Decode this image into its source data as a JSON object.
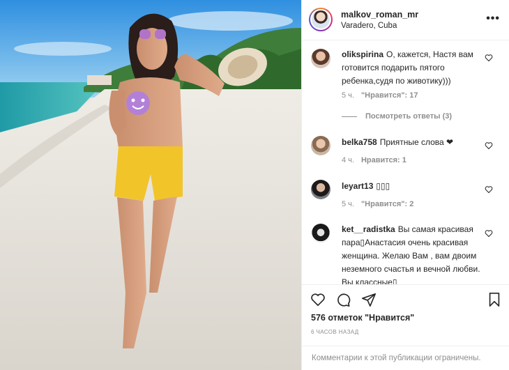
{
  "post": {
    "username": "malkov_roman_mr",
    "location": "Varadero, Cuba",
    "more_icon": "more-options-icon"
  },
  "comments": [
    {
      "username": "olikspirina",
      "text": "О, кажется, Настя вам готовится подарить пятого ребенка,судя по животику)))",
      "time": "5 ч.",
      "likes": "\"Нравится\": 17",
      "reply_label": "Посмотреть ответы (3)"
    },
    {
      "username": "belka758",
      "text": "Приятные слова ❤",
      "time": "4 ч.",
      "likes": "Нравится: 1"
    },
    {
      "username": "leyart13",
      "text": "▯▯▯",
      "time": "5 ч.",
      "likes": "\"Нравится\": 2"
    },
    {
      "username": "ket__radistka",
      "text": "Вы самая красивая пара▯Анастасия очень красивая женщина. Желаю Вам , вам двоим неземного счастья и вечной любви. Вы классные▯"
    }
  ],
  "actions": {
    "likes_text": "576 отметок \"Нравится\"",
    "time_ago": "6 ЧАСОВ НАЗАД",
    "comments_restricted": "Комментарии к этой публикации ограничены."
  },
  "icons": [
    "heart-icon",
    "comment-icon",
    "share-icon",
    "bookmark-icon"
  ],
  "colors": {
    "text": "#262626",
    "muted": "#8e8e8e",
    "border": "#efefef"
  }
}
